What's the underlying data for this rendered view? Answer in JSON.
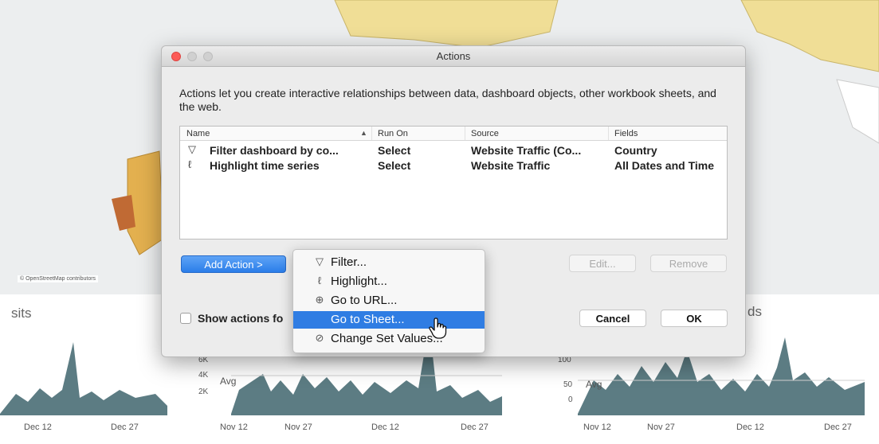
{
  "background": {
    "left_title": "sits",
    "right_title": "ds",
    "osm_credit": "© OpenStreetMap contributors",
    "left_ticks": [
      "Dec 12",
      "Dec 27"
    ],
    "mid_ticks": [
      "Nov 12",
      "Nov 27",
      "Dec 12",
      "Dec 27"
    ],
    "right_ticks": [
      "Nov 12",
      "Nov 27",
      "Dec 12",
      "Dec 27"
    ],
    "mid_y_ticks": [
      "6K",
      "4K",
      "2K"
    ],
    "mid_avg": "Avg",
    "right_y_ticks": [
      "100",
      "50",
      "0"
    ],
    "right_avg": "Avg",
    "colors": {
      "chart_fill": "#5c7c83",
      "map_land": "#f0de96",
      "map_water": "#eef0f1"
    }
  },
  "dialog": {
    "title": "Actions",
    "description": "Actions let you create interactive relationships between data, dashboard objects, other workbook sheets, and the web.",
    "columns": {
      "name": "Name",
      "run_on": "Run On",
      "source": "Source",
      "fields": "Fields"
    },
    "rows": [
      {
        "icon": "filter-icon",
        "name": "Filter dashboard by co...",
        "run_on": "Select",
        "source": "Website Traffic (Co...",
        "fields": "Country"
      },
      {
        "icon": "highlight-icon",
        "name": "Highlight time series",
        "run_on": "Select",
        "source": "Website Traffic",
        "fields": "All Dates and Time"
      }
    ],
    "add_action_label": "Add Action >",
    "edit_label": "Edit...",
    "remove_label": "Remove",
    "show_actions_label": "Show actions fo",
    "show_actions_checked": false,
    "cancel_label": "Cancel",
    "ok_label": "OK"
  },
  "menu": {
    "items": [
      {
        "icon": "filter-icon",
        "label": "Filter..."
      },
      {
        "icon": "highlight-icon",
        "label": "Highlight..."
      },
      {
        "icon": "globe-icon",
        "label": "Go to URL..."
      },
      {
        "icon": "sheet-icon",
        "label": "Go to Sheet...",
        "selected": true
      },
      {
        "icon": "set-values-icon",
        "label": "Change Set Values..."
      }
    ]
  }
}
